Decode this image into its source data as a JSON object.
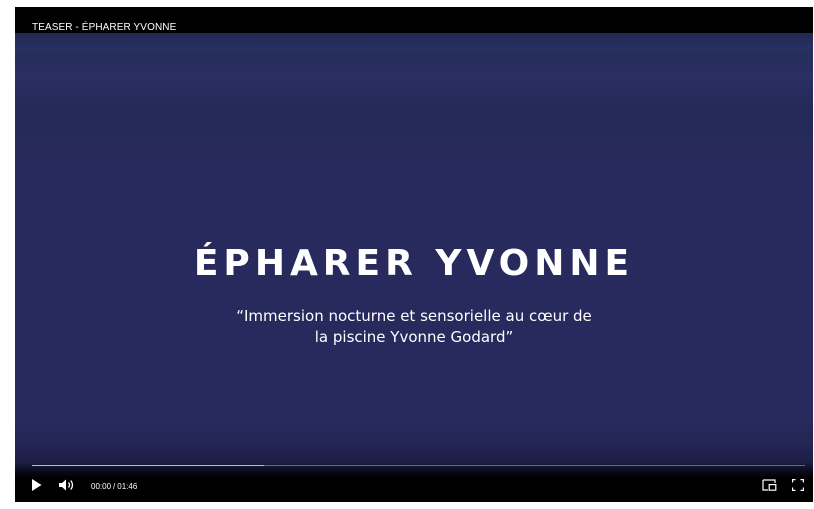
{
  "player": {
    "title": "TEASER - ÉPHARER YVONNE",
    "frame": {
      "headline": "ÉPHARER YVONNE",
      "subtitle_line1": "“Immersion nocturne et sensorielle au cœur de",
      "subtitle_line2": "la piscine Yvonne Godard”"
    },
    "controls": {
      "current_time": "00:00",
      "separator": "/",
      "duration": "01:46",
      "progress": 0,
      "buffered": 0.3,
      "icons": {
        "play": "play-icon",
        "volume": "volume-icon",
        "pip": "picture-in-picture-icon",
        "fullscreen": "fullscreen-icon"
      }
    }
  },
  "colors": {
    "frame_background": "#28295c",
    "text": "#ffffff",
    "chrome": "#000000"
  }
}
